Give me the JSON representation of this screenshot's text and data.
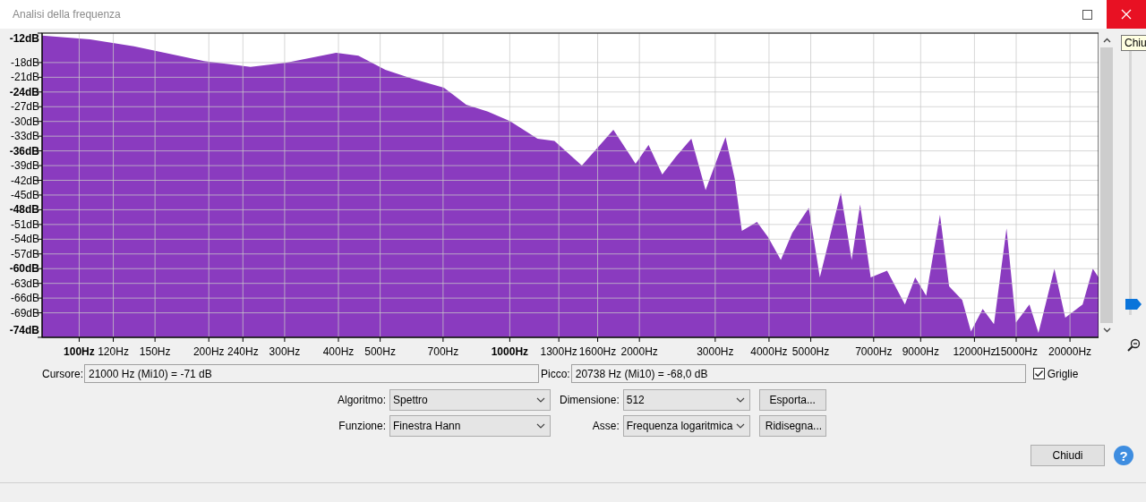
{
  "window": {
    "title": "Analisi della frequenza",
    "tooltip": "Chiu"
  },
  "plot": {
    "kind": "spectrum",
    "y_labels": [
      {
        "text": "-12dB",
        "bold": true
      },
      {
        "text": "-18dB",
        "bold": false
      },
      {
        "text": "-21dB",
        "bold": false
      },
      {
        "text": "-24dB",
        "bold": true
      },
      {
        "text": "-27dB",
        "bold": false
      },
      {
        "text": "-30dB",
        "bold": false
      },
      {
        "text": "-33dB",
        "bold": false
      },
      {
        "text": "-36dB",
        "bold": true
      },
      {
        "text": "-39dB",
        "bold": false
      },
      {
        "text": "-42dB",
        "bold": false
      },
      {
        "text": "-45dB",
        "bold": false
      },
      {
        "text": "-48dB",
        "bold": true
      },
      {
        "text": "-51dB",
        "bold": false
      },
      {
        "text": "-54dB",
        "bold": false
      },
      {
        "text": "-57dB",
        "bold": false
      },
      {
        "text": "-60dB",
        "bold": true
      },
      {
        "text": "-63dB",
        "bold": false
      },
      {
        "text": "-66dB",
        "bold": false
      },
      {
        "text": "-69dB",
        "bold": false
      },
      {
        "text": "-74dB",
        "bold": true
      }
    ],
    "x_labels": [
      {
        "text": "100Hz",
        "bold": true
      },
      {
        "text": "120Hz",
        "bold": false
      },
      {
        "text": "150Hz",
        "bold": false
      },
      {
        "text": "200Hz",
        "bold": false
      },
      {
        "text": "240Hz",
        "bold": false
      },
      {
        "text": "300Hz",
        "bold": false
      },
      {
        "text": "400Hz",
        "bold": false
      },
      {
        "text": "500Hz",
        "bold": false
      },
      {
        "text": "700Hz",
        "bold": false
      },
      {
        "text": "1000Hz",
        "bold": true
      },
      {
        "text": "1300Hz",
        "bold": false
      },
      {
        "text": "1600Hz",
        "bold": false
      },
      {
        "text": "2000Hz",
        "bold": false
      },
      {
        "text": "3000Hz",
        "bold": false
      },
      {
        "text": "4000Hz",
        "bold": false
      },
      {
        "text": "5000Hz",
        "bold": false
      },
      {
        "text": "7000Hz",
        "bold": false
      },
      {
        "text": "9000Hz",
        "bold": false
      },
      {
        "text": "12000Hz",
        "bold": false
      },
      {
        "text": "15000Hz",
        "bold": false
      },
      {
        "text": "20000Hz",
        "bold": false
      }
    ]
  },
  "zoom": {
    "level": 0.04
  },
  "cursor": {
    "label": "Cursore:",
    "value": "21000 Hz (Mi10) = -71 dB"
  },
  "peak": {
    "label": "Picco:",
    "value": "20738 Hz (Mi10) = -68,0 dB"
  },
  "grid": {
    "label": "Griglie",
    "checked": true
  },
  "settings": [
    {
      "label": "Algoritmo:",
      "value": "Spettro"
    },
    {
      "label": "Dimensione:",
      "value": "512"
    },
    {
      "label": "Funzione:",
      "value": "Finestra Hann"
    },
    {
      "label": "Asse:",
      "value": "Frequenza logaritmica"
    }
  ],
  "actions": [
    "Esporta...",
    "Ridisegna..."
  ],
  "close_button": "Chiudi",
  "help": "?"
}
